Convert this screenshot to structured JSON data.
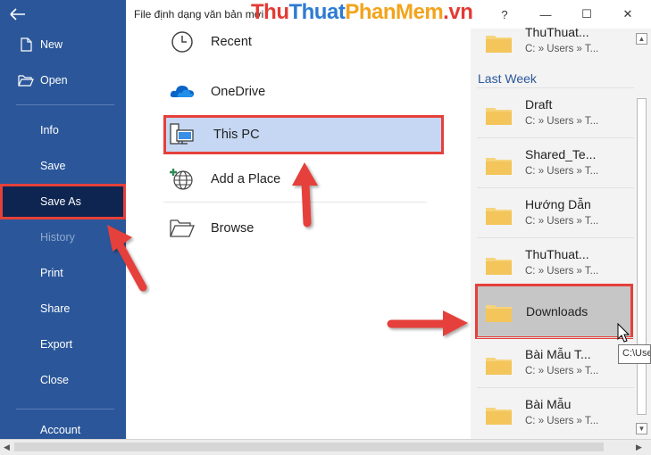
{
  "window": {
    "title": "File định dạng văn bản mới",
    "help": "?",
    "minimize": "—",
    "maximize": "☐",
    "close": "✕"
  },
  "watermark": {
    "part1": "Thu",
    "part2": "Thuat",
    "part3": "PhanMem",
    "part4": ".vn"
  },
  "sidebar": {
    "items": [
      {
        "label": "New",
        "icon": "new-document-icon"
      },
      {
        "label": "Open",
        "icon": "open-folder-icon"
      },
      {
        "label": "Info"
      },
      {
        "label": "Save"
      },
      {
        "label": "Save As",
        "state": "active"
      },
      {
        "label": "History",
        "state": "disabled"
      },
      {
        "label": "Print"
      },
      {
        "label": "Share"
      },
      {
        "label": "Export"
      },
      {
        "label": "Close"
      },
      {
        "label": "Account"
      }
    ],
    "bg_color": "#2b579a",
    "active_color": "#0d2550"
  },
  "locations": [
    {
      "label": "Recent",
      "icon": "clock-icon"
    },
    {
      "label": "OneDrive",
      "icon": "cloud-icon"
    },
    {
      "label": "This PC",
      "icon": "computer-icon",
      "state": "selected"
    },
    {
      "label": "Add a Place",
      "icon": "globe-add-icon"
    },
    {
      "label": "Browse",
      "icon": "folder-open-icon"
    }
  ],
  "recent": {
    "top_item": {
      "name": "ThuThuat...",
      "path": "C: » Users » T..."
    },
    "section_label": "Last Week",
    "items": [
      {
        "name": "Draft",
        "path": "C: » Users » T..."
      },
      {
        "name": "Shared_Te...",
        "path": "C: » Users » T..."
      },
      {
        "name": "Hướng Dẫn",
        "path": "C: » Users » T..."
      },
      {
        "name": "ThuThuat...",
        "path": "C: » Users » T..."
      },
      {
        "name": "Downloads",
        "path": "",
        "state": "hover"
      },
      {
        "name": "Bài Mẫu T...",
        "path": "C: » Users » T..."
      },
      {
        "name": "Bài Mẫu",
        "path": "C: » Users » T..."
      }
    ]
  },
  "tooltip": {
    "text": "C:\\Users"
  },
  "colors": {
    "highlight_red": "#e5403a",
    "selected_blue": "#c5d7f2",
    "folder_yellow": "#f6d47c",
    "section_blue": "#2b579a"
  }
}
